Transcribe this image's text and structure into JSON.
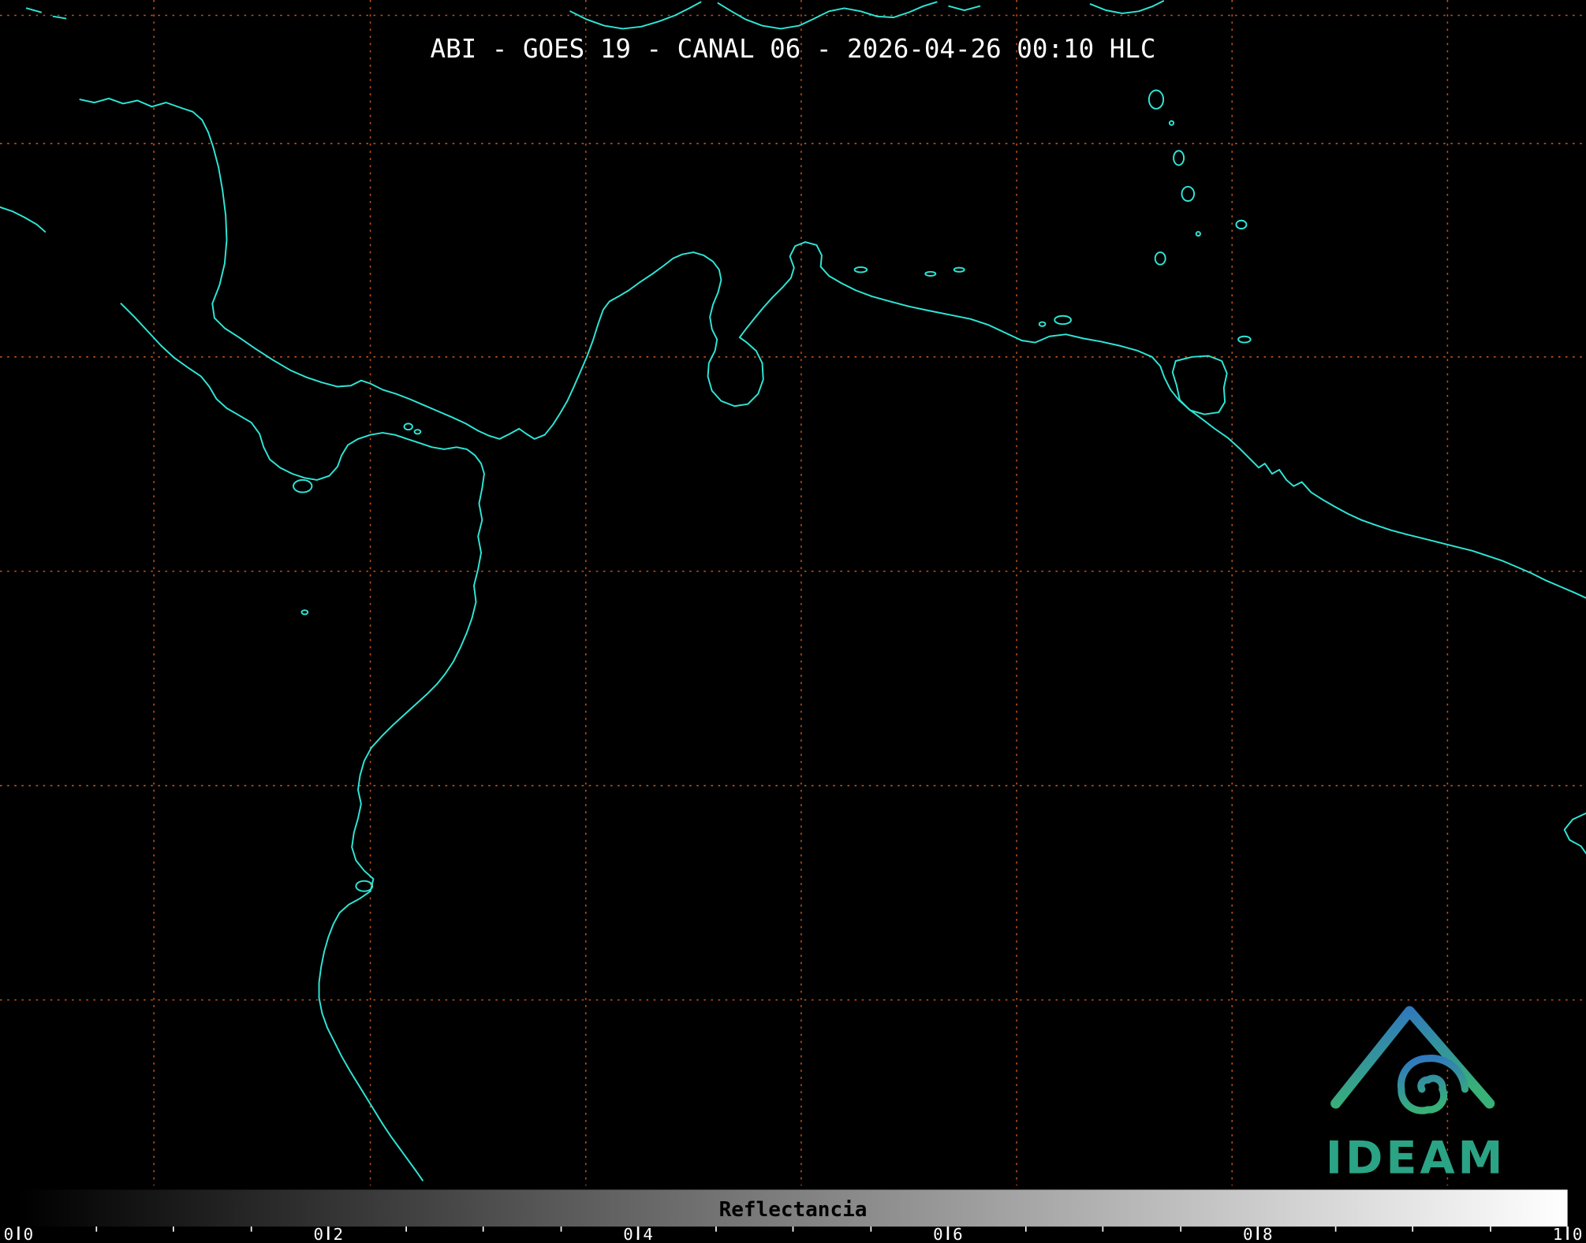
{
  "header": {
    "title": "ABI - GOES 19 - CANAL 06 - 2026-04-26 00:10 HLC"
  },
  "map": {
    "background_color": "#000000",
    "coastline_color": "#2ee6d6",
    "graticule_color": "#c35217"
  },
  "colorbar": {
    "label": "Reflectancia",
    "tick_labels": [
      "0.0",
      "0.2",
      "0.4",
      "0.6",
      "0.8",
      "1.0"
    ],
    "min": 0.0,
    "max": 1.0,
    "gradient_start": "#000000",
    "gradient_end": "#ffffff"
  },
  "logo": {
    "text": "IDEAM",
    "text_color": "#2ba385",
    "gradient_top": "#2f74c4",
    "gradient_bottom": "#38b077"
  }
}
